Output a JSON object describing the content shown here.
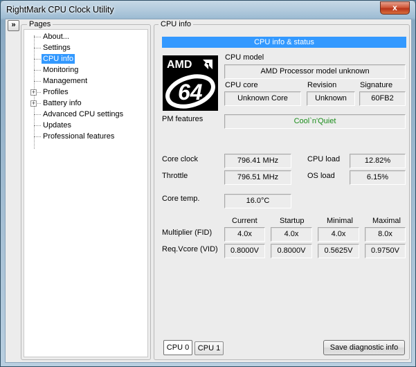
{
  "window": {
    "title": "RightMark CPU Clock Utility",
    "close_glyph": "x"
  },
  "expand_glyph": "»",
  "pages": {
    "label": "Pages",
    "items": [
      {
        "label": "About..."
      },
      {
        "label": "Settings"
      },
      {
        "label": "CPU info",
        "selected": true
      },
      {
        "label": "Monitoring"
      },
      {
        "label": "Management"
      },
      {
        "label": "Profiles",
        "expandable": true
      },
      {
        "label": "Battery info",
        "expandable": true
      },
      {
        "label": "Advanced CPU settings"
      },
      {
        "label": "Updates"
      },
      {
        "label": "Professional features"
      }
    ],
    "plus_glyph": "+"
  },
  "cpuinfo": {
    "group_label": "CPU info",
    "header": "CPU info & status",
    "logo": {
      "brand_text": "AMD",
      "sub_text": "64"
    },
    "cpu_model_label": "CPU model",
    "cpu_model": "AMD Processor model unknown",
    "cpu_core_label": "CPU core",
    "cpu_core": "Unknown Core",
    "revision_label": "Revision",
    "revision": "Unknown",
    "signature_label": "Signature",
    "signature": "60FB2",
    "pm_features_label": "PM features",
    "pm_features": "Cool`n'Quiet",
    "core_clock_label": "Core clock",
    "core_clock": "796.41 MHz",
    "throttle_label": "Throttle",
    "throttle": "796.51 MHz",
    "cpu_load_label": "CPU load",
    "cpu_load": "12.82%",
    "os_load_label": "OS load",
    "os_load": "6.15%",
    "core_temp_label": "Core temp.",
    "core_temp": "16.0°C",
    "col_current": "Current",
    "col_startup": "Startup",
    "col_minimal": "Minimal",
    "col_maximal": "Maximal",
    "multiplier_label": "Multiplier (FID)",
    "multiplier": [
      "4.0x",
      "4.0x",
      "4.0x",
      "8.0x"
    ],
    "vcore_label": "Req.Vcore (VID)",
    "vcore": [
      "0.8000V",
      "0.8000V",
      "0.5625V",
      "0.9750V"
    ],
    "tabs": [
      "CPU 0",
      "CPU 1"
    ],
    "save_button": "Save diagnostic info"
  },
  "colors": {
    "accent": "#3399ff",
    "pm_green": "#1a8c1a"
  }
}
